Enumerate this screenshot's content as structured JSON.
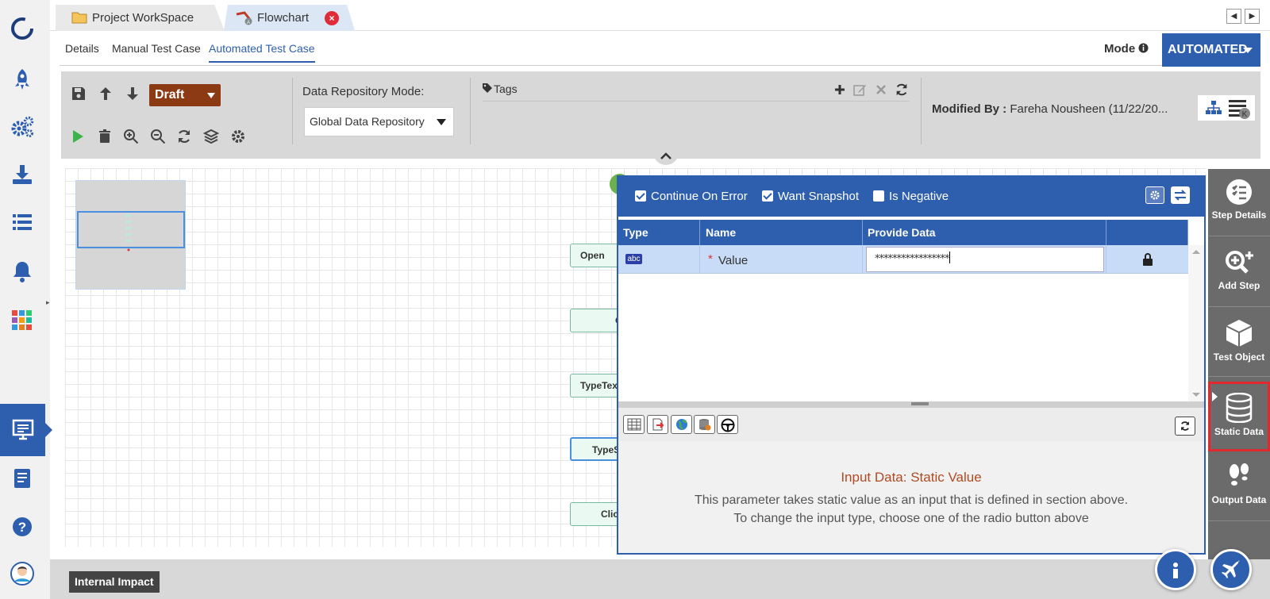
{
  "tabs": [
    {
      "label": "Project WorkSpace",
      "icon": "folder-icon",
      "active": false
    },
    {
      "label": "Flowchart",
      "icon": "flowchart-icon",
      "active": true,
      "close": "×"
    }
  ],
  "nav": {
    "prev": "◀",
    "next": "▶"
  },
  "subtabs": [
    "Details",
    "Manual Test Case",
    "Automated Test Case"
  ],
  "mode": {
    "label": "Mode",
    "value": "AUTOMATED"
  },
  "toolbar": {
    "status": "Draft",
    "repo_label": "Data Repository Mode:",
    "repo_value": "Global Data Repository",
    "tags_label": "Tags",
    "modified_label": "Modified By :",
    "modified_value": "Fareha Nousheen (11/22/20..."
  },
  "flow_nodes": [
    "Open",
    "C",
    "TypeTex",
    "TypeS",
    "Clic"
  ],
  "panel": {
    "checks": [
      {
        "label": "Continue On Error",
        "checked": true
      },
      {
        "label": "Want Snapshot",
        "checked": true
      },
      {
        "label": "Is Negative",
        "checked": false
      }
    ],
    "columns": [
      "Type",
      "Name",
      "Provide Data"
    ],
    "row": {
      "type_badge": "abc",
      "required": "*",
      "name": "Value",
      "data": "*****************"
    },
    "info_title": "Input Data: Static Value",
    "info_line1": "This parameter takes static value as an input that is defined in section above.",
    "info_line2": "To change the input type, choose one of the radio button above"
  },
  "right_panel": [
    {
      "label": "Step Details",
      "icon": "step-details-icon"
    },
    {
      "label": "Add Step",
      "icon": "add-step-icon"
    },
    {
      "label": "Test Object",
      "icon": "test-object-icon"
    },
    {
      "label": "Static Data",
      "icon": "database-icon",
      "active": true
    },
    {
      "label": "Output Data",
      "icon": "footprints-icon"
    }
  ],
  "footer": {
    "impact": "Internal Impact"
  },
  "colors": {
    "primary": "#2e5fae",
    "draft": "#8b3a14",
    "highlight": "#e0282e",
    "info_title": "#b14a22"
  }
}
